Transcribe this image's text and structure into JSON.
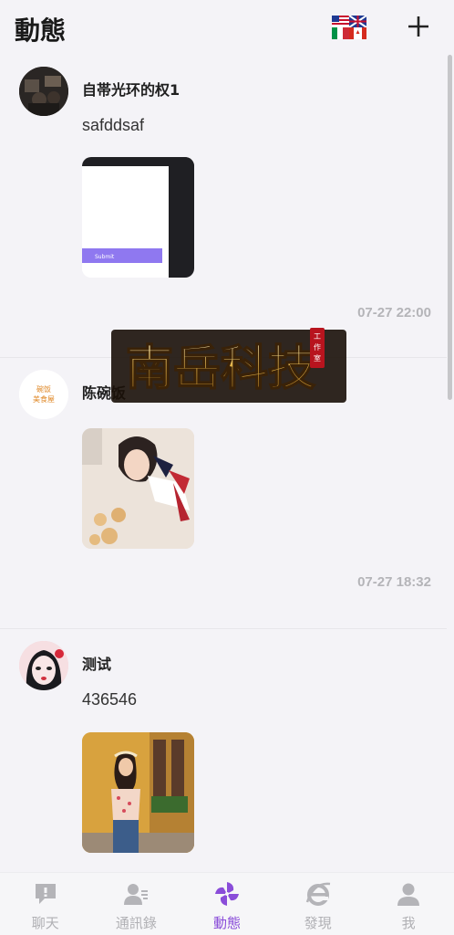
{
  "header": {
    "title": "動態",
    "flag_icon": "flags-icon",
    "add_icon": "plus-icon",
    "add_label": "+"
  },
  "posts": [
    {
      "username": "自帯光环的权1",
      "text": "safddsaf",
      "time": "07-27 22:00",
      "image_button_label": "Submit"
    },
    {
      "username": "陈碗饭",
      "text": "",
      "time": "07-27 18:32",
      "avatar_text": "碗饭 美食屋"
    },
    {
      "username": "测试",
      "text": "436546",
      "time": ""
    }
  ],
  "watermark": {
    "text": "南岳科技",
    "seal": "工作室"
  },
  "tabs": [
    {
      "label": "聊天",
      "icon": "chat-icon",
      "active": false
    },
    {
      "label": "通訊錄",
      "icon": "contacts-icon",
      "active": false
    },
    {
      "label": "動態",
      "icon": "pinwheel-icon",
      "active": true
    },
    {
      "label": "發現",
      "icon": "browser-icon",
      "active": false
    },
    {
      "label": "我",
      "icon": "person-icon",
      "active": false
    }
  ],
  "colors": {
    "accent": "#8a4dd9",
    "tab_inactive": "#b0b0b4",
    "time": "#b4b4b8"
  }
}
